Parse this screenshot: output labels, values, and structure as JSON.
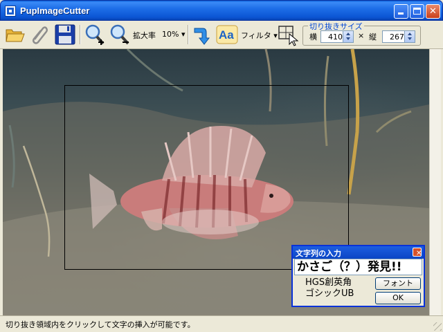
{
  "window": {
    "title": "PupImageCutter",
    "minimize_label": "_",
    "close_label": "✕"
  },
  "toolbar": {
    "icons": [
      "folder-open-icon",
      "paperclip-icon",
      "save-disk-icon",
      "zoom-in-icon",
      "zoom-out-icon",
      "rotate-arrow-icon",
      "text-aa-icon",
      "crop-select-icon"
    ],
    "zoom_label": "拡大率",
    "zoom_value": "10%",
    "zoom_arrow": "▾",
    "text_button_label": "Aa",
    "filter_label": "フィルタ",
    "filter_arrow": "▾",
    "crop_size_group_label": "切り抜きサイズ",
    "width_label": "横",
    "width_value": "410",
    "times_sign": "×",
    "height_label": "縦",
    "height_value": "267"
  },
  "canvas": {
    "image_subject": "lionfish on sandy seabed"
  },
  "dialog": {
    "title": "文字列の入力",
    "close_label": "✕",
    "text_value": "かさご（？）発見!!",
    "font_name_line1": "HGS創英角",
    "font_name_line2": "ゴシックUB",
    "font_button_label": "フォント",
    "ok_button_label": "OK"
  },
  "statusbar": {
    "text": "切り抜き領域内をクリックして文字の挿入が可能です。"
  },
  "colors": {
    "titlebar_blue": "#0b55d4",
    "toolbar_bg": "#ece9d8",
    "group_label_blue": "#0046d5",
    "close_red": "#d8532a"
  }
}
